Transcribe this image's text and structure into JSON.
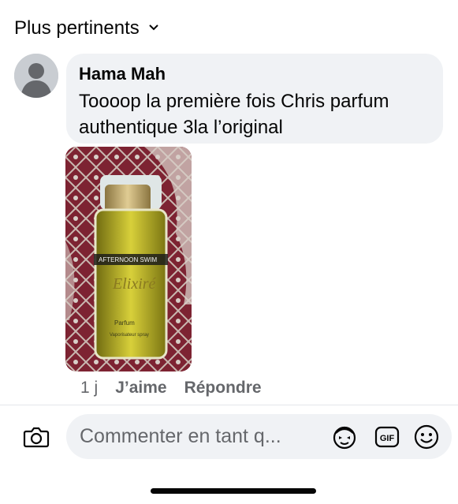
{
  "sort": {
    "label": "Plus pertinents",
    "icon": "chevron-down-icon"
  },
  "comment": {
    "author": "Hama Mah",
    "text_line1": "Toooop la première fois Chris parfum",
    "text_line2": "authentique 3la l’original",
    "avatar_icon": "default-avatar-icon",
    "photo": {
      "brand_line": "AFTERNOON SWIM",
      "name": "Elixiré",
      "label": "Parfum",
      "sub": "Vaporisateur spray"
    },
    "time": "1 j",
    "like_label": "J’aime",
    "reply_label": "Répondre"
  },
  "composer": {
    "placeholder": "Commenter en tant q...",
    "camera_icon": "camera-icon",
    "avatar_sticker_icon": "avatar-sticker-icon",
    "gif_label": "GIF",
    "emoji_icon": "emoji-icon"
  },
  "colors": {
    "bubble": "#f0f2f5",
    "secondary_text": "#65676b",
    "primary_text": "#050505"
  }
}
